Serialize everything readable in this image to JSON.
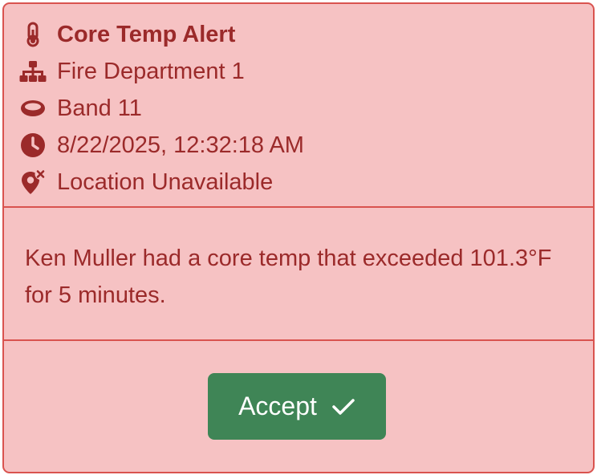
{
  "alert": {
    "title": "Core Temp Alert",
    "department": "Fire Department 1",
    "band": "Band 11",
    "timestamp": "8/22/2025, 12:32:18 AM",
    "location": "Location Unavailable",
    "message": "Ken Muller had a core temp that exceeded 101.3°F for 5 minutes.",
    "accept_label": "Accept"
  },
  "icons": {
    "title": "thermometer-icon",
    "department": "org-chart-icon",
    "band": "band-ring-icon",
    "timestamp": "clock-icon",
    "location": "location-off-icon",
    "accept": "checkmark-icon"
  },
  "colors": {
    "card_background": "#f6c2c3",
    "card_border": "#d9534f",
    "text": "#9b2a2a",
    "accept_button": "#3f8556",
    "accept_text": "#ffffff"
  }
}
